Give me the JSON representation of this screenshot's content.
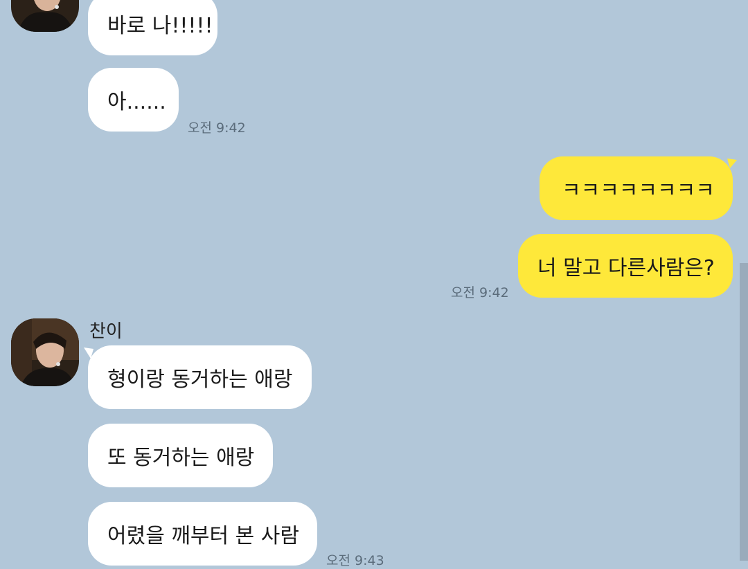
{
  "chat": {
    "messages": [
      {
        "text": "바로 나!!!!!"
      },
      {
        "text": "아......"
      },
      {
        "text": "ㅋㅋㅋㅋㅋㅋㅋㅋ"
      },
      {
        "text": "너 말고 다른사람은?"
      },
      {
        "text": "형이랑 동거하는 애랑"
      },
      {
        "text": "또 동거하는 애랑"
      },
      {
        "text": "어렸을 깨부터 본 사람"
      }
    ],
    "times": [
      "오전 9:42",
      "오전 9:42",
      "오전 9:43"
    ],
    "sender": "찬이"
  },
  "colors": {
    "background": "#b2c7d9",
    "incoming_bubble": "#ffffff",
    "outgoing_bubble": "#fee83a"
  }
}
